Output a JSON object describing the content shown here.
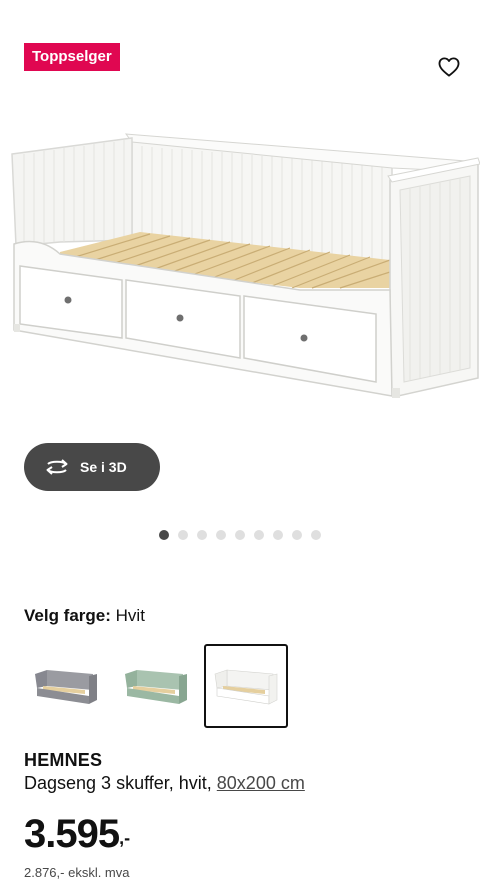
{
  "badge": {
    "label": "Toppselger",
    "color": "#e00751"
  },
  "favorite": {
    "icon": "heart-outline-icon"
  },
  "view3d": {
    "label": "Se i 3D",
    "icon": "rotate-3d-icon"
  },
  "carousel": {
    "count": 9,
    "active_index": 0
  },
  "color_select": {
    "label": "Velg farge:",
    "value": "Hvit"
  },
  "swatches": [
    {
      "name": "grey",
      "color": "#8c8d93",
      "selected": false
    },
    {
      "name": "green",
      "color": "#9bb8a3",
      "selected": false
    },
    {
      "name": "white",
      "color": "#f3f3f1",
      "selected": true
    }
  ],
  "product": {
    "name": "HEMNES",
    "description": "Dagseng 3 skuffer, hvit, ",
    "size_link": "80x200 cm",
    "price": "3.595",
    "price_suffix": ",-",
    "ex_vat": "2.876,- ekskl. mva"
  }
}
